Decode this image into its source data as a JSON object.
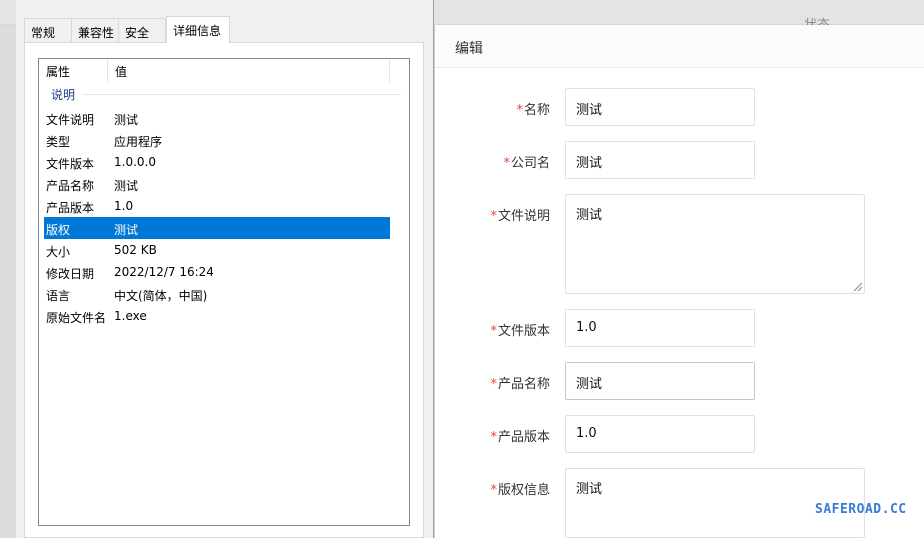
{
  "background": {
    "top_label": "状态"
  },
  "dialog": {
    "tabs": [
      {
        "label": "常规"
      },
      {
        "label": "兼容性"
      },
      {
        "label": "安全"
      },
      {
        "label": "详细信息"
      }
    ],
    "active_tab": "详细信息",
    "columns": {
      "property": "属性",
      "value": "值"
    },
    "group": "说明",
    "rows": [
      {
        "key": "文件说明",
        "value": "测试"
      },
      {
        "key": "类型",
        "value": "应用程序"
      },
      {
        "key": "文件版本",
        "value": "1.0.0.0"
      },
      {
        "key": "产品名称",
        "value": "测试"
      },
      {
        "key": "产品版本",
        "value": "1.0"
      },
      {
        "key": "版权",
        "value": "测试"
      },
      {
        "key": "大小",
        "value": "502 KB"
      },
      {
        "key": "修改日期",
        "value": "2022/12/7 16:24"
      },
      {
        "key": "语言",
        "value": "中文(简体，中国)"
      },
      {
        "key": "原始文件名",
        "value": "1.exe"
      }
    ],
    "selected_row": "版权",
    "selection_color": "#0078d7"
  },
  "form": {
    "title": "编辑",
    "required_mark": "*",
    "required_color": "#e64340",
    "fields": {
      "name": {
        "label": "名称",
        "value": "测试"
      },
      "company": {
        "label": "公司名",
        "value": "测试"
      },
      "file_desc": {
        "label": "文件说明",
        "value": "测试"
      },
      "file_version": {
        "label": "文件版本",
        "value": "1.0"
      },
      "product_name": {
        "label": "产品名称",
        "value": "测试"
      },
      "product_version": {
        "label": "产品版本",
        "value": "1.0"
      },
      "copyright": {
        "label": "版权信息",
        "value": "测试"
      }
    }
  },
  "watermark": "SAFEROAD.CC"
}
